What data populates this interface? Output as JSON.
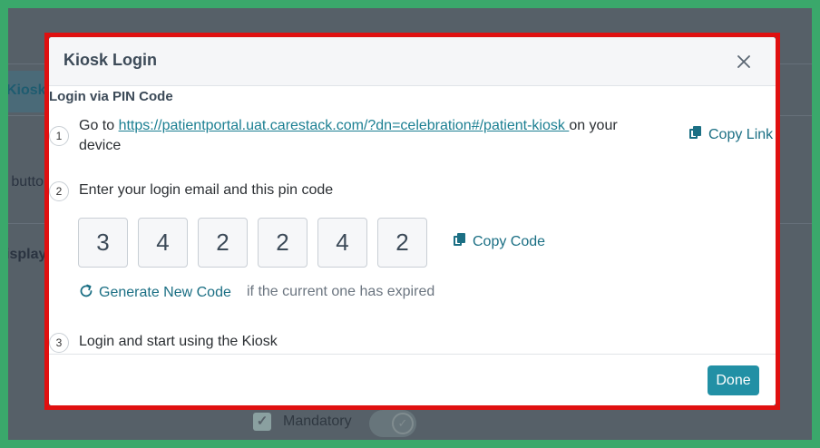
{
  "background": {
    "tab_label": "Kiosk",
    "fragment_button": "’ butto",
    "fragment_display": "isplay",
    "mandatory_label": "Mandatory"
  },
  "modal": {
    "title": "Kiosk Login",
    "close_icon": "close-icon",
    "section_title": "Login via PIN Code",
    "steps": [
      {
        "number": "1",
        "prefix": "Go to ",
        "link": "https://patientportal.uat.carestack.com/?dn=celebration#/patient-kiosk ",
        "suffix": "on your device"
      },
      {
        "number": "2",
        "text": "Enter your login email and this pin code"
      },
      {
        "number": "3",
        "text": "Login and start using the Kiosk"
      }
    ],
    "copy_link_label": "Copy Link",
    "pin_digits": [
      "3",
      "4",
      "2",
      "2",
      "4",
      "2"
    ],
    "copy_code_label": "Copy Code",
    "generate_label": "Generate New Code",
    "generate_hint": "if the current one has expired",
    "done_label": "Done"
  },
  "colors": {
    "accent": "#2290a5",
    "link": "#1b7f92",
    "outline": "#e01010",
    "frame": "#3aa86b"
  }
}
